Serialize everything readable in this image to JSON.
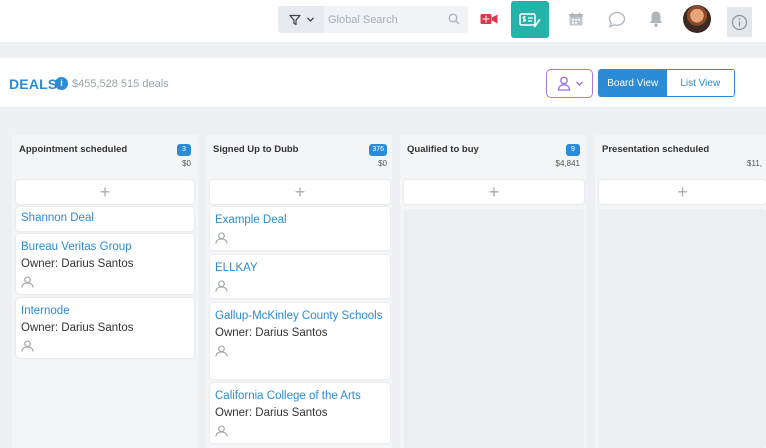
{
  "topbar": {
    "search": {
      "placeholder": "Global Search"
    },
    "icons": [
      "filter-icon",
      "chevron-down-icon",
      "search-icon",
      "video-icon",
      "deals-icon",
      "calendar-icon",
      "chat-icon",
      "bell-icon",
      "avatar",
      "info-icon"
    ]
  },
  "header": {
    "title": "DEALS",
    "info_badge": "i",
    "summary": "$455,528 515 deals",
    "views": {
      "board": "Board View",
      "list": "List View"
    }
  },
  "columns": [
    {
      "title": "Appointment scheduled",
      "count": "3",
      "total": "$0",
      "add_label": "+",
      "cards": [
        {
          "name": "Shannon Deal"
        },
        {
          "name": "Bureau Veritas Group",
          "owner": "Owner: Darius Santos"
        },
        {
          "name": "Internode",
          "owner": "Owner: Darius Santos"
        }
      ]
    },
    {
      "title": "Signed Up to Dubb",
      "count": "376",
      "total": "$0",
      "add_label": "+",
      "cards": [
        {
          "name": "Example Deal"
        },
        {
          "name": "ELLKAY"
        },
        {
          "name": "Gallup-McKinley County Schools",
          "owner": "Owner: Darius Santos"
        },
        {
          "name": "California College of the Arts",
          "owner": "Owner: Darius Santos"
        }
      ]
    },
    {
      "title": "Qualified to buy",
      "count": "9",
      "total": "$4,841",
      "add_label": "+"
    },
    {
      "title": "Presentation scheduled",
      "total": "$11,",
      "add_label": "+"
    }
  ],
  "colors": {
    "primary": "#2b8bd6",
    "teal": "#25b2a8",
    "purple": "#a57be0",
    "video_red": "#e0354a"
  }
}
